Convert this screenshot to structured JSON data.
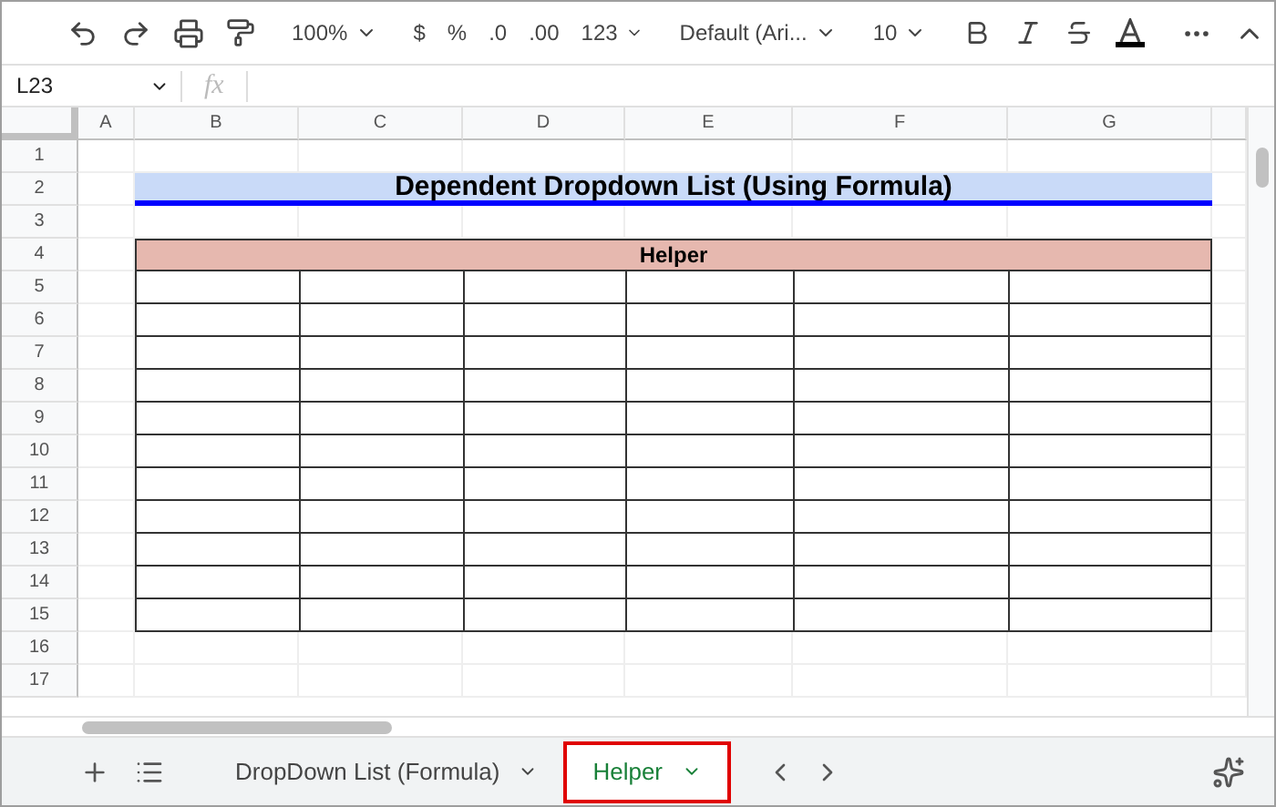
{
  "toolbar": {
    "zoom": "100%",
    "currency": "$",
    "percent": "%",
    "decrease_decimals": ".0",
    "increase_decimals": ".00",
    "number_format": "123",
    "font": "Default (Ari...",
    "font_size": "10"
  },
  "formula_bar": {
    "name_box": "L23",
    "fx": "fx"
  },
  "columns": [
    "A",
    "B",
    "C",
    "D",
    "E",
    "F",
    "G"
  ],
  "rows": [
    "1",
    "2",
    "3",
    "4",
    "5",
    "6",
    "7",
    "8",
    "9",
    "10",
    "11",
    "12",
    "13",
    "14",
    "15",
    "16",
    "17"
  ],
  "title": "Dependent Dropdown List (Using Formula)",
  "helper_header": "Helper",
  "sheet_tabs": [
    {
      "label": "DropDown List (Formula)",
      "selected": false
    },
    {
      "label": "Helper",
      "selected": true
    }
  ]
}
